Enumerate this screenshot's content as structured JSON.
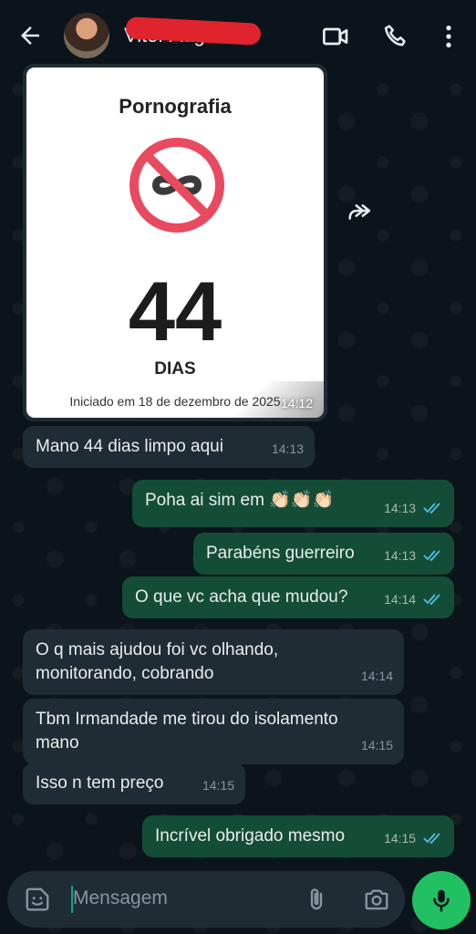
{
  "header": {
    "contact_name": "Vitor Augusto",
    "back_icon": "back-arrow-icon",
    "video_icon": "video-call-icon",
    "call_icon": "phone-icon",
    "menu_icon": "more-vert-icon"
  },
  "image_card": {
    "title": "Pornografia",
    "symbol": "no-infinity-icon",
    "days": "44",
    "unit": "DIAS",
    "started": "Iniciado em 18 de dezembro de 2025",
    "time": "14:12"
  },
  "messages": [
    {
      "dir": "in",
      "text": "Mano 44 dias limpo aqui",
      "time": "14:13"
    },
    {
      "dir": "out",
      "text": "Poha ai sim em 👏🏻👏🏻👏🏻",
      "time": "14:13"
    },
    {
      "dir": "out",
      "text": "Parabéns guerreiro",
      "time": "14:13"
    },
    {
      "dir": "out",
      "text": "O que vc acha que mudou?",
      "time": "14:14"
    },
    {
      "dir": "in",
      "text": "O q mais ajudou foi vc olhando, monitorando, cobrando",
      "time": "14:14"
    },
    {
      "dir": "in",
      "text": "Tbm Irmandade me tirou do isolamento mano",
      "time": "14:15"
    },
    {
      "dir": "in",
      "text": "Isso n tem preço",
      "time": "14:15"
    },
    {
      "dir": "out",
      "text": "Incrível obrigado mesmo",
      "time": "14:15"
    }
  ],
  "input": {
    "placeholder": "Mensagem"
  },
  "colors": {
    "background": "#0b141a",
    "incoming": "#202c33",
    "outgoing": "#144d37",
    "accent": "#21c063",
    "read_ticks": "#53bdeb"
  }
}
